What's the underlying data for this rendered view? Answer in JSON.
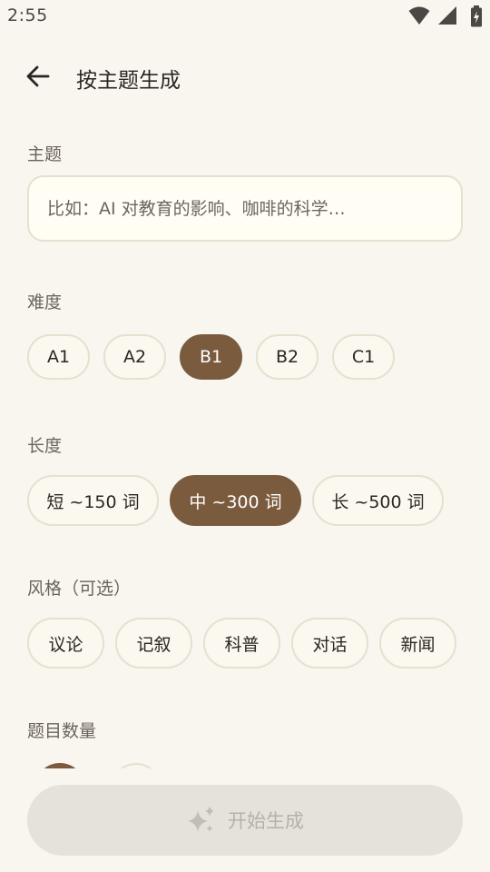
{
  "status_bar": {
    "time": "2:55",
    "icons": [
      "wifi-icon",
      "signal-icon",
      "battery-charging-icon"
    ]
  },
  "app_bar": {
    "back_icon": "arrow-left-icon",
    "title": "按主题生成"
  },
  "topic": {
    "label": "主题",
    "placeholder": "比如：AI 对教育的影响、咖啡的科学…",
    "value": ""
  },
  "difficulty": {
    "label": "难度",
    "options": [
      "A1",
      "A2",
      "B1",
      "B2",
      "C1"
    ],
    "selected": "B1"
  },
  "length": {
    "label": "长度",
    "options": [
      "短 ~150 词",
      "中 ~300 词",
      "长 ~500 词"
    ],
    "selected": "中 ~300 词"
  },
  "style": {
    "label": "风格（可选）",
    "options": [
      "议论",
      "记叙",
      "科普",
      "对话",
      "新闻"
    ]
  },
  "question_count": {
    "label": "题目数量"
  },
  "actions": {
    "start_label": "开始生成",
    "start_enabled": false,
    "start_icon": "sparkle-icon"
  },
  "colors": {
    "background": "#f9f5ef",
    "accent": "#7b5b3e",
    "chip_border": "#e6e0cf",
    "disabled_button": "#e5e2dc"
  }
}
